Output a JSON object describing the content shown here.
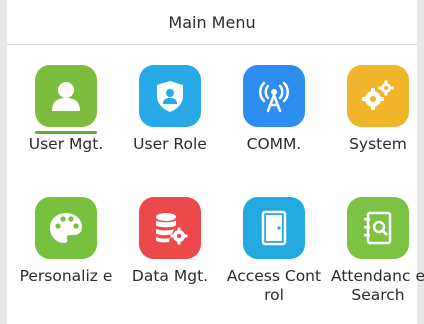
{
  "header": {
    "title": "Main Menu"
  },
  "menu": [
    {
      "label": "User Mgt.",
      "icon": "user-icon",
      "color": "#7cbc3e",
      "selected": true
    },
    {
      "label": "User Role",
      "icon": "user-role-shield-icon",
      "color": "#2aa9e8"
    },
    {
      "label": "COMM.",
      "icon": "signal-tower-icon",
      "color": "#2d8df0"
    },
    {
      "label": "System",
      "icon": "gears-icon",
      "color": "#f0b52a"
    },
    {
      "label": "Personalize",
      "icon": "palette-icon",
      "color": "#78c13e"
    },
    {
      "label": "Data Mgt.",
      "icon": "database-gear-icon",
      "color": "#ec4a4a"
    },
    {
      "label": "Access Control",
      "icon": "door-icon",
      "color": "#23a9df"
    },
    {
      "label": "Attendance Search",
      "icon": "notebook-search-icon",
      "color": "#7cc243"
    }
  ],
  "labels_display": {
    "p4": "Personaliz e",
    "a6": "Access Control",
    "a7": "Attendanc e Search"
  }
}
